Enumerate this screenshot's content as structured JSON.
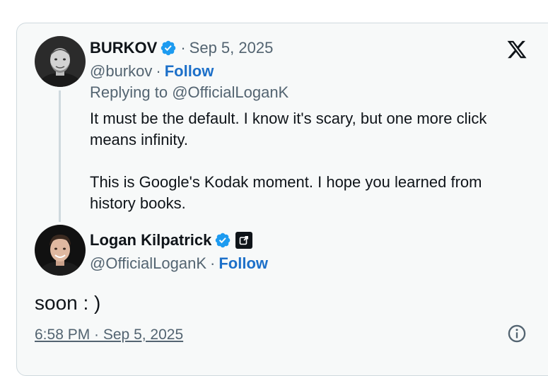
{
  "colors": {
    "card_background": "#f7f9f9",
    "card_border": "#cfd9de",
    "text": "#0f1419",
    "muted": "#536471",
    "follow": "#1d70c9",
    "verified_badge": "#1d9bf0"
  },
  "brand": {
    "logo_icon": "x-logo-icon"
  },
  "parent_tweet": {
    "author_name": "BURKOV",
    "verified": true,
    "date": "Sep 5, 2025",
    "handle": "@burkov",
    "follow_label": "Follow",
    "replying_to_label": "Replying to",
    "replying_to_handle": "@OfficialLoganK",
    "text_paragraphs": [
      "It must be the default. I know it's scary, but one more click means infinity.",
      "This is Google's Kodak moment. I hope you learned from history books."
    ]
  },
  "reply_tweet": {
    "author_name": "Logan Kilpatrick",
    "verified": true,
    "affiliate_badge_icon": "affiliate-badge-icon",
    "handle": "@OfficialLoganK",
    "follow_label": "Follow",
    "text": "soon : )",
    "timestamp": "6:58 PM · Sep 5, 2025"
  },
  "separator": "·"
}
